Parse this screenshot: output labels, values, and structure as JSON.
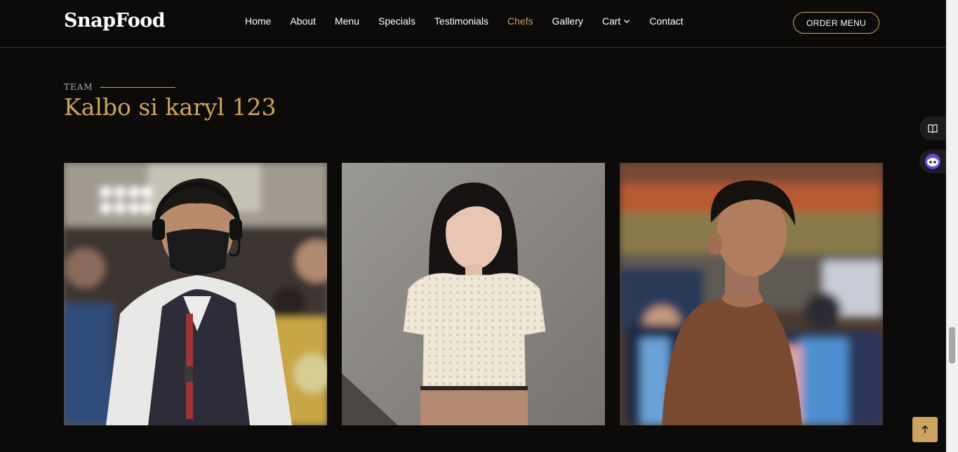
{
  "header": {
    "logo": "SnapFood",
    "nav": [
      {
        "label": "Home",
        "active": false
      },
      {
        "label": "About",
        "active": false
      },
      {
        "label": "Menu",
        "active": false
      },
      {
        "label": "Specials",
        "active": false
      },
      {
        "label": "Testimonials",
        "active": false
      },
      {
        "label": "Chefs",
        "active": true
      },
      {
        "label": "Gallery",
        "active": false
      },
      {
        "label": "Cart",
        "active": false,
        "dropdown": true
      },
      {
        "label": "Contact",
        "active": false
      }
    ],
    "order_button": "ORDER MENU"
  },
  "section": {
    "label": "TEAM",
    "title": "Kalbo si karyl 123"
  },
  "chefs": [
    {
      "photo": "chef-photo-1"
    },
    {
      "photo": "chef-photo-2"
    },
    {
      "photo": "chef-photo-3"
    }
  ],
  "colors": {
    "background": "#0c0b09",
    "accent": "#cda45e",
    "text": "#ffffff"
  },
  "icons": {
    "side_top": "book-icon",
    "side_bottom": "assistant-icon",
    "back_to_top": "arrow-up-icon"
  }
}
